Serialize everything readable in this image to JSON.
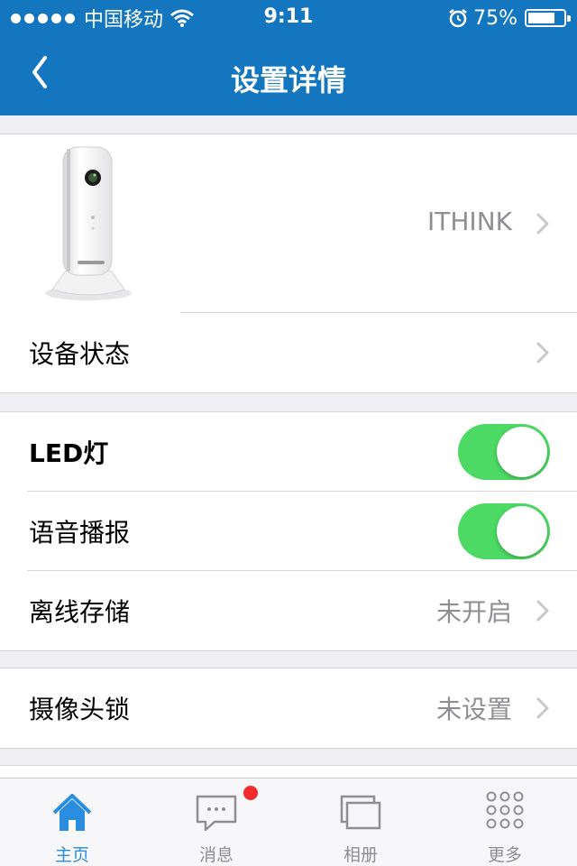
{
  "status_bar": {
    "carrier": "中国移动",
    "time": "9:11",
    "battery_percent_text": "75%",
    "battery_level": 0.75
  },
  "nav": {
    "title": "设置详情"
  },
  "device": {
    "name": "ITHINK"
  },
  "rows": {
    "device_status": {
      "label": "设备状态"
    },
    "led": {
      "label": "LED灯",
      "on": true
    },
    "voice": {
      "label": "语音播报",
      "on": true
    },
    "offline_storage": {
      "label": "离线存储",
      "value": "未开启"
    },
    "camera_lock": {
      "label": "摄像头锁",
      "value": "未设置"
    }
  },
  "tabs": [
    {
      "label": "主页",
      "icon": "home-icon",
      "active": true
    },
    {
      "label": "消息",
      "icon": "message-icon",
      "badge": true
    },
    {
      "label": "相册",
      "icon": "album-icon"
    },
    {
      "label": "更多",
      "icon": "more-grid-icon"
    }
  ],
  "colors": {
    "nav_bg": "#1576c0",
    "toggle_on": "#4cd964",
    "tab_active": "#2a8de0",
    "badge": "#f02c2c"
  }
}
